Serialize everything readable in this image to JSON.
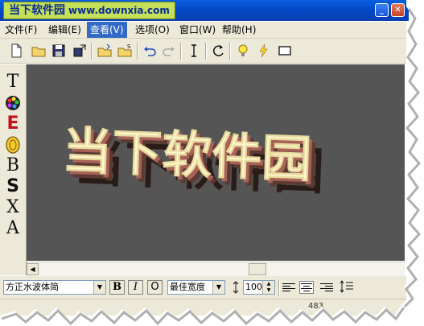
{
  "window": {
    "title": "当下软件园",
    "site": "www.downxia.com",
    "buttons": [
      "minimize",
      "maximize",
      "close"
    ]
  },
  "menubar": {
    "items": [
      {
        "label": "文件(F)"
      },
      {
        "label": "编辑(E)"
      },
      {
        "label": "查看(V)",
        "active": true
      },
      {
        "label": "选项(O)"
      },
      {
        "label": "窗口(W)"
      },
      {
        "label": "帮助(H)"
      }
    ]
  },
  "toolbar": {
    "icons": [
      "new-file-icon",
      "open-folder-icon",
      "save-icon",
      "export-icon",
      "open-image-icon",
      "open-special-icon",
      "undo-icon",
      "redo-icon",
      "text-cursor-icon",
      "rotate-icon",
      "bulb-icon",
      "lightning-icon",
      "rectangle-icon"
    ]
  },
  "toolbox": {
    "tools": [
      {
        "name": "text-tool-icon",
        "glyph": "T"
      },
      {
        "name": "color-palette-icon",
        "glyph": ""
      },
      {
        "name": "edit-text-icon",
        "glyph": "E"
      },
      {
        "name": "coin-icon",
        "glyph": ""
      },
      {
        "name": "letter-b-icon",
        "glyph": "B"
      },
      {
        "name": "letter-s-icon",
        "glyph": "S"
      },
      {
        "name": "letter-x-icon",
        "glyph": "X"
      },
      {
        "name": "font-style-icon",
        "glyph": "A"
      }
    ]
  },
  "canvas": {
    "text": "当下软件园",
    "background": "#555555",
    "face_color": "#fff8d0",
    "side_color": "#5b3a30"
  },
  "formatbar": {
    "font_name": "方正水波体简",
    "bold_label": "B",
    "italic_label": "I",
    "outline_label": "O",
    "width_mode": "最佳宽度",
    "size_value": "100"
  },
  "statusbar": {
    "position": "483"
  }
}
